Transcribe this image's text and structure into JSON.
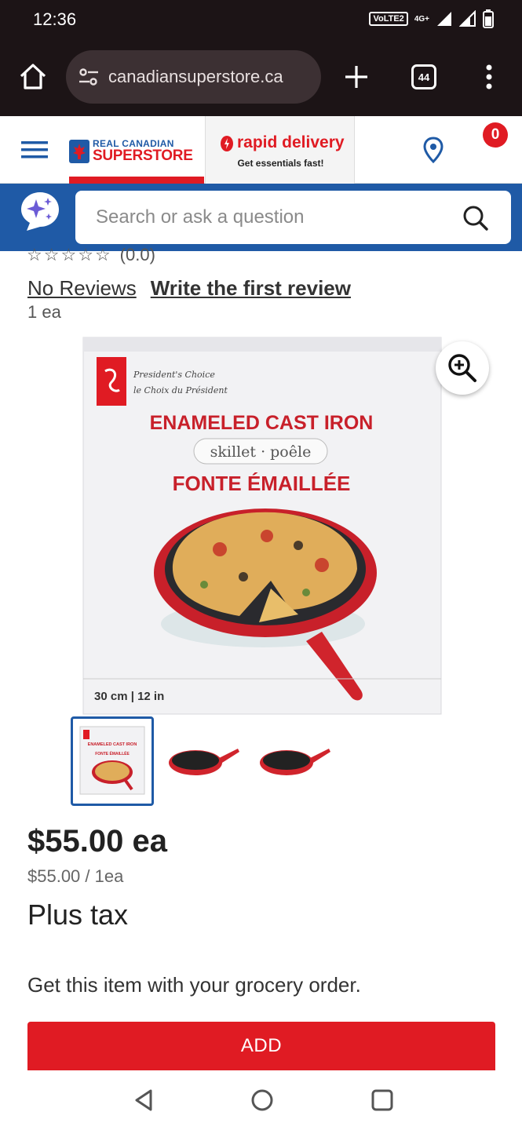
{
  "status_bar": {
    "time": "12:36",
    "volte": "VoLTE2",
    "network": "4G+"
  },
  "browser": {
    "url": "canadiansuperstore.ca",
    "tab_count": "44"
  },
  "header": {
    "logo_line1": "REAL CANADIAN",
    "logo_line2": "SUPERSTORE",
    "rapid_title": "rapid delivery",
    "rapid_sub": "Get essentials fast!",
    "cart_count": "0"
  },
  "search": {
    "placeholder": "Search or ask a question"
  },
  "product": {
    "rating": "(0.0)",
    "rating_stars": 0,
    "no_reviews": "No Reviews",
    "write_review": "Write the first review",
    "unit": "1 ea",
    "box_brand_line1": "President's Choice",
    "box_brand_line2": "le Choix du Président",
    "box_title_en": "ENAMELED CAST IRON",
    "box_subtitle": "skillet · poêle",
    "box_title_fr": "FONTE ÉMAILLÉE",
    "box_size": "30 cm | 12 in",
    "thumb_title": "ENAMELED CAST IRON",
    "thumb_subtitle": "FONTE ÉMAILLÉE",
    "price": "$55.00 ea",
    "unit_price": "$55.00 / 1ea",
    "tax_note": "Plus tax",
    "grocery_note": "Get this item with your grocery order.",
    "add_label": "ADD"
  },
  "colors": {
    "brand_red": "#e01b23",
    "brand_blue": "#1f5aa6",
    "browser_dark": "#1c1416"
  }
}
